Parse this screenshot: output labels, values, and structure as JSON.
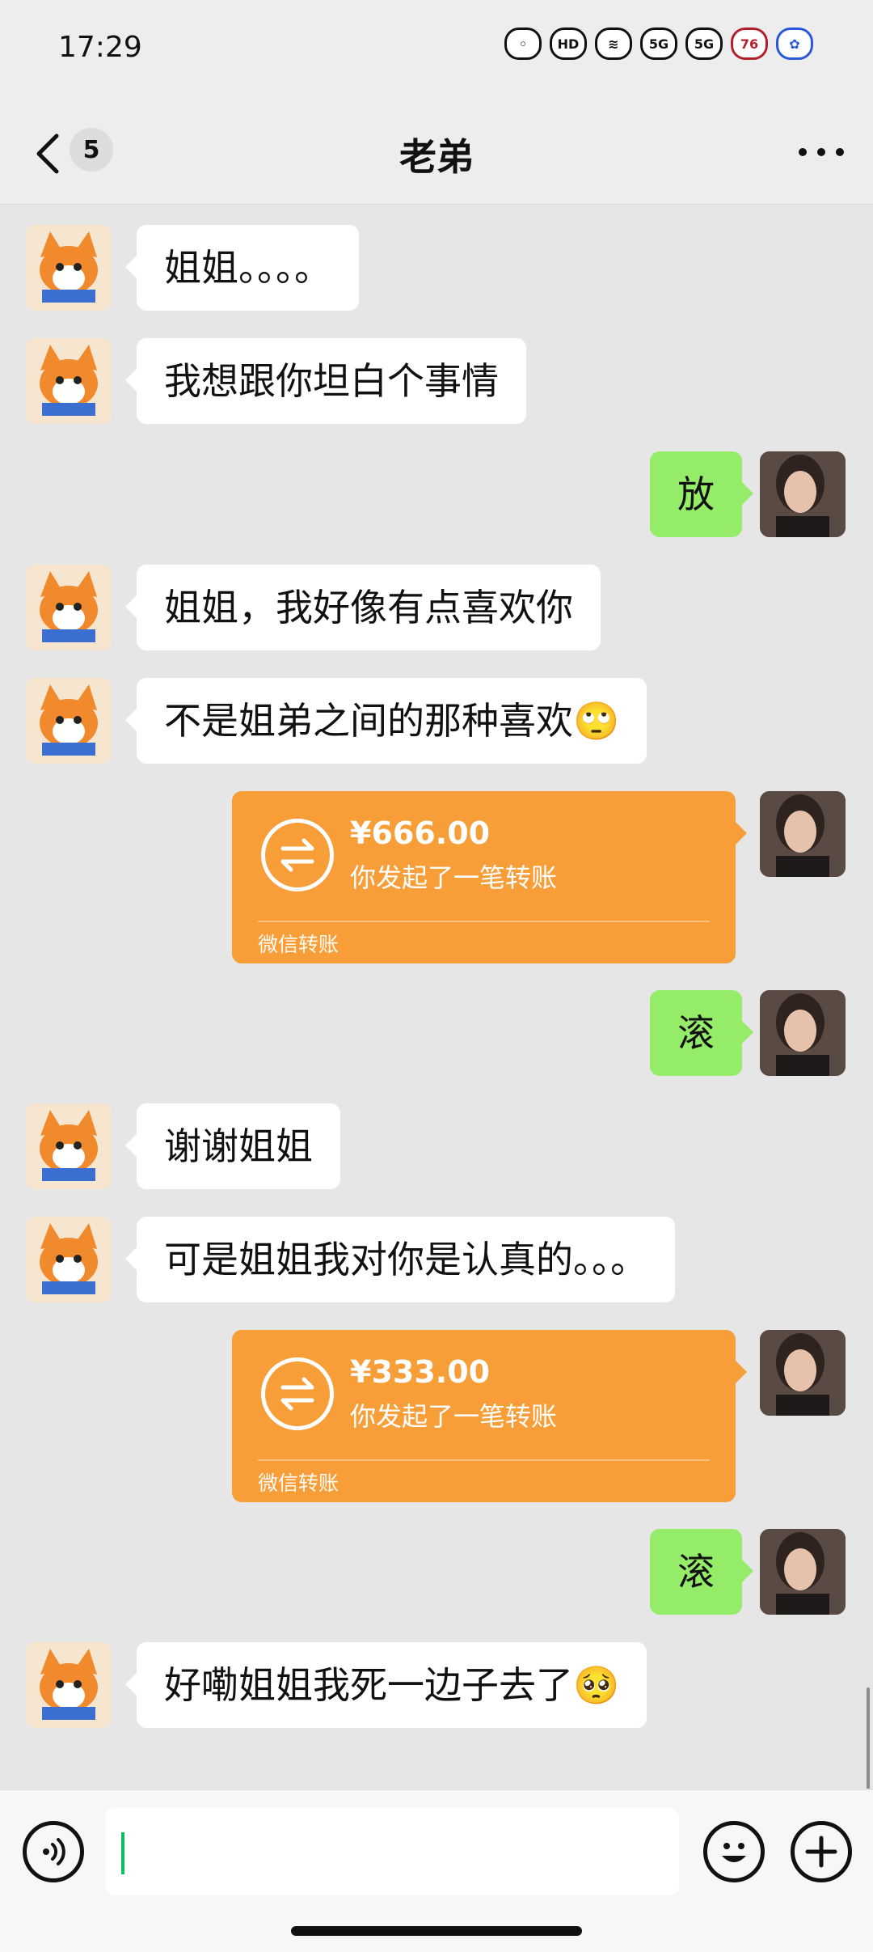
{
  "status": {
    "time": "17:29",
    "battery": "76"
  },
  "header": {
    "back_count": "5",
    "title": "老弟"
  },
  "messages": [
    {
      "side": "left",
      "text": "姐姐。。。。"
    },
    {
      "side": "left",
      "text": "我想跟你坦白个事情"
    },
    {
      "side": "right",
      "text": "放"
    },
    {
      "side": "left",
      "text": "姐姐，我好像有点喜欢你"
    },
    {
      "side": "left",
      "text": "不是姐弟之间的那种喜欢🙄"
    },
    {
      "side": "right",
      "type": "transfer",
      "amount": "¥666.00",
      "desc": "你发起了一笔转账",
      "label": "微信转账"
    },
    {
      "side": "right",
      "text": "滚"
    },
    {
      "side": "left",
      "text": "谢谢姐姐"
    },
    {
      "side": "left",
      "text": "可是姐姐我对你是认真的。。。"
    },
    {
      "side": "right",
      "type": "transfer",
      "amount": "¥333.00",
      "desc": "你发起了一笔转账",
      "label": "微信转账"
    },
    {
      "side": "right",
      "text": "滚"
    },
    {
      "side": "left",
      "text": "好嘞姐姐我死一边子去了🥺"
    }
  ]
}
